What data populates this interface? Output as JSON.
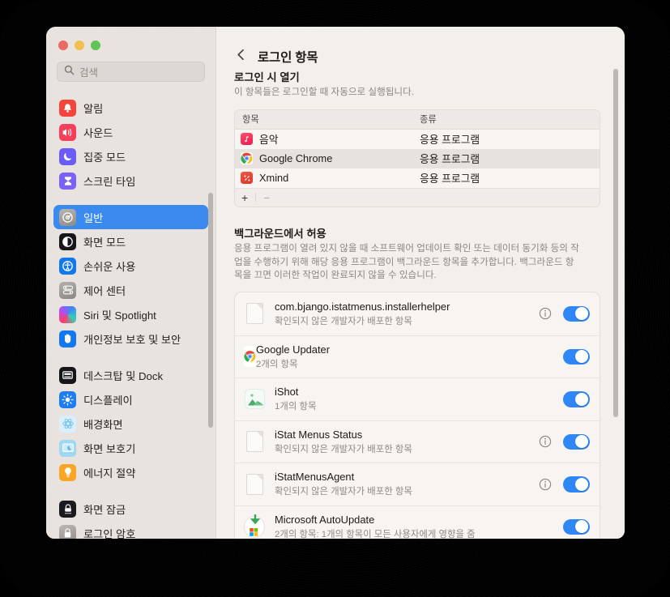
{
  "window": {
    "traffic_lights": [
      "close",
      "minimize",
      "maximize"
    ],
    "colors": {
      "accent_blue": "#3a8af0",
      "toggle_blue": "#2f86f6",
      "sidebar_bg": "#e8e3df",
      "content_bg": "#f3efeb",
      "card_bg": "#f7f4f1",
      "frame": "#000000"
    }
  },
  "sidebar": {
    "search": {
      "placeholder": "검색",
      "value": "",
      "icon": "search-icon"
    },
    "items": [
      {
        "label": "알림",
        "icon": "notifications-icon",
        "selected": false,
        "gap_after": false
      },
      {
        "label": "사운드",
        "icon": "sound-icon",
        "selected": false,
        "gap_after": false
      },
      {
        "label": "집중 모드",
        "icon": "focus-mode-icon",
        "selected": false,
        "gap_after": false
      },
      {
        "label": "스크린 타임",
        "icon": "screen-time-icon",
        "selected": false,
        "gap_after": true
      },
      {
        "label": "일반",
        "icon": "general-gear-icon",
        "selected": true,
        "gap_after": false
      },
      {
        "label": "화면 모드",
        "icon": "appearance-icon",
        "selected": false,
        "gap_after": false
      },
      {
        "label": "손쉬운 사용",
        "icon": "accessibility-icon",
        "selected": false,
        "gap_after": false
      },
      {
        "label": "제어 센터",
        "icon": "control-center-icon",
        "selected": false,
        "gap_after": false
      },
      {
        "label": "Siri 및 Spotlight",
        "icon": "siri-icon",
        "selected": false,
        "gap_after": false
      },
      {
        "label": "개인정보 보호 및 보안",
        "icon": "privacy-hand-icon",
        "selected": false,
        "gap_after": true
      },
      {
        "label": "데스크탑 및 Dock",
        "icon": "desktop-dock-icon",
        "selected": false,
        "gap_after": false
      },
      {
        "label": "디스플레이",
        "icon": "display-icon",
        "selected": false,
        "gap_after": false
      },
      {
        "label": "배경화면",
        "icon": "wallpaper-icon",
        "selected": false,
        "gap_after": false
      },
      {
        "label": "화면 보호기",
        "icon": "screensaver-icon",
        "selected": false,
        "gap_after": false
      },
      {
        "label": "에너지 절약",
        "icon": "energy-saver-icon",
        "selected": false,
        "gap_after": true
      },
      {
        "label": "화면 잠금",
        "icon": "lock-screen-icon",
        "selected": false,
        "gap_after": false
      },
      {
        "label": "로그인 암호",
        "icon": "login-password-icon",
        "selected": false,
        "gap_after": false
      }
    ]
  },
  "header": {
    "back_icon": "chevron-left-icon",
    "title": "로그인 항목"
  },
  "login_items_section": {
    "title": "로그인 시 열기",
    "description": "이 항목들은 로그인할 때 자동으로 실행됩니다.",
    "columns": [
      "항목",
      "종류"
    ],
    "rows": [
      {
        "name": "음악",
        "kind": "응용 프로그램",
        "icon": "music-app-icon",
        "highlighted": false
      },
      {
        "name": "Google Chrome",
        "kind": "응용 프로그램",
        "icon": "chrome-app-icon",
        "highlighted": true
      },
      {
        "name": "Xmind",
        "kind": "응용 프로그램",
        "icon": "xmind-app-icon",
        "highlighted": false
      }
    ],
    "add_label": "+",
    "remove_label": "−"
  },
  "background_section": {
    "title": "백그라운드에서 허용",
    "description": "응용 프로그램이 열려 있지 않을 때 소프트웨어 업데이트 확인 또는 데이터 동기화 등의 작업을 수행하기 위해 해당 응용 프로그램이 백그라운드 항목을 추가합니다. 백그라운드 항목을 끄면 이러한 작업이 완료되지 않을 수 있습니다.",
    "rows": [
      {
        "name": "com.bjango.istatmenus.installerhelper",
        "subtitle": "확인되지 않은 개발자가 배포한 항목",
        "icon": "generic-document-icon",
        "has_info": true,
        "info_icon": "info-circle-icon",
        "enabled": true
      },
      {
        "name": "Google Updater",
        "subtitle": "2개의 항목",
        "icon": "chrome-app-icon",
        "has_info": false,
        "info_icon": "info-circle-icon",
        "enabled": true
      },
      {
        "name": "iShot",
        "subtitle": "1개의 항목",
        "icon": "ishot-app-icon",
        "has_info": false,
        "info_icon": "info-circle-icon",
        "enabled": true
      },
      {
        "name": "iStat Menus Status",
        "subtitle": "확인되지 않은 개발자가 배포한 항목",
        "icon": "generic-document-icon",
        "has_info": true,
        "info_icon": "info-circle-icon",
        "enabled": true
      },
      {
        "name": "iStatMenusAgent",
        "subtitle": "확인되지 않은 개발자가 배포한 항목",
        "icon": "generic-document-icon",
        "has_info": true,
        "info_icon": "info-circle-icon",
        "enabled": true
      },
      {
        "name": "Microsoft AutoUpdate",
        "subtitle": "2개의 항목: 1개의 항목이 모든 사용자에게 영향을 줌",
        "icon": "microsoft-autoupdate-icon",
        "has_info": false,
        "info_icon": "info-circle-icon",
        "enabled": true
      }
    ]
  }
}
